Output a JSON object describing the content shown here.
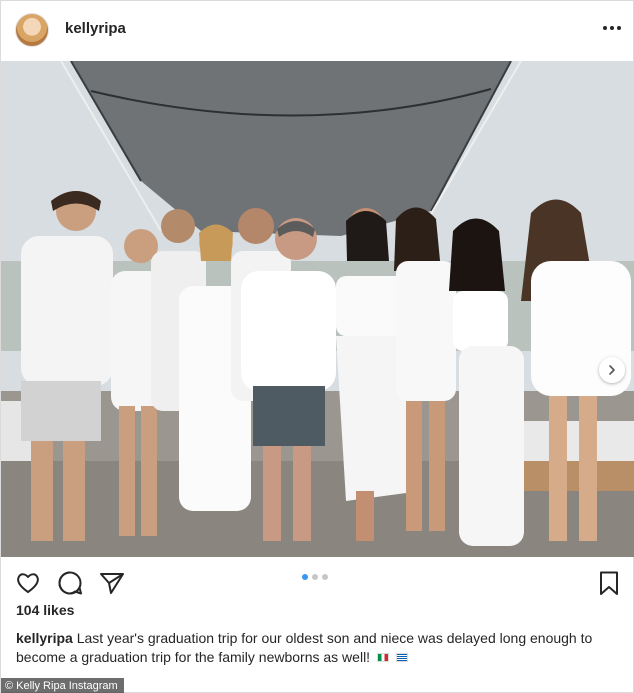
{
  "header": {
    "username": "kellyripa",
    "avatar_icon": "profile-avatar",
    "more_icon": "more-options-icon"
  },
  "post": {
    "image_icon": "group-photo",
    "carousel": {
      "count": 3,
      "active_index": 0
    },
    "next_icon": "chevron-right-icon"
  },
  "actions": {
    "like_icon": "heart-icon",
    "comment_icon": "comment-icon",
    "share_icon": "paper-plane-icon",
    "save_icon": "bookmark-icon"
  },
  "likes": "104 likes",
  "caption": {
    "username": "kellyripa",
    "text": "Last year's graduation trip for our oldest son and niece was delayed long enough to become a graduation trip for the family newborns as well!",
    "flags": [
      "italy-flag",
      "greece-flag"
    ]
  },
  "credit": "© Kelly Ripa Instagram",
  "colors": {
    "text": "#262626",
    "carousel_active": "#3897f0",
    "carousel_inactive": "#c7c7c7",
    "border": "#dbdbdb"
  }
}
